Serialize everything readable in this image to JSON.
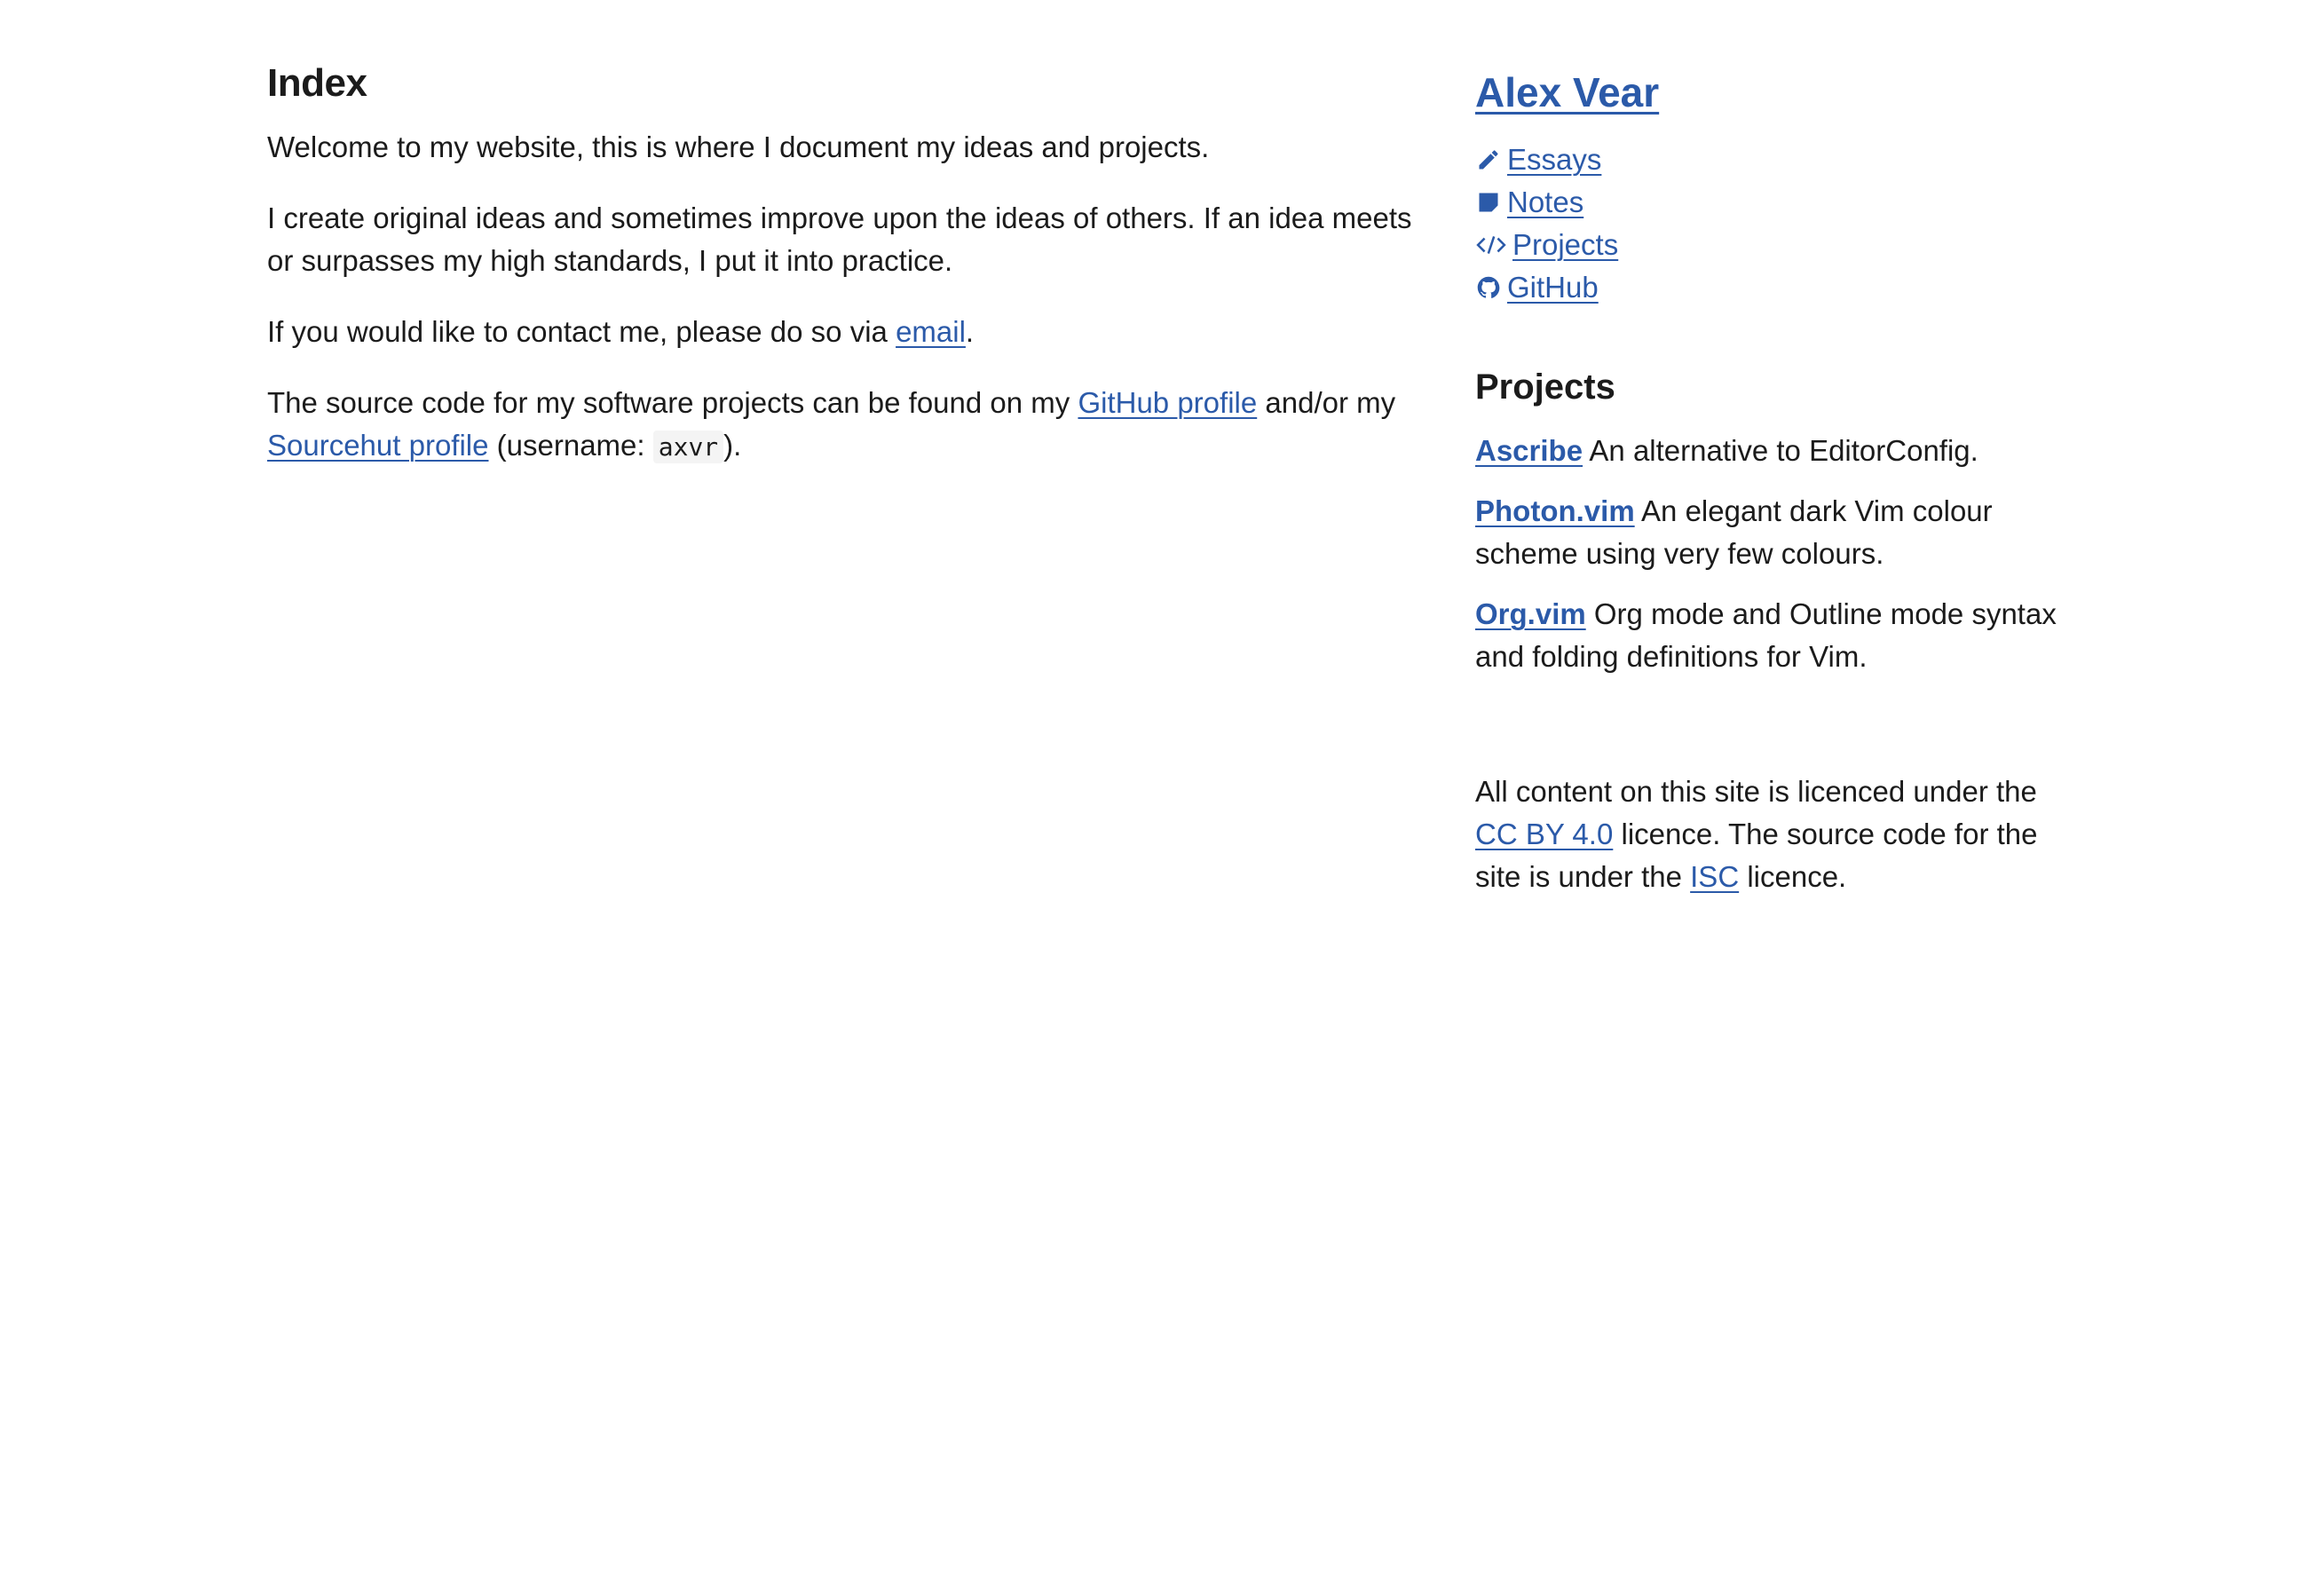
{
  "main": {
    "title": "Index",
    "intro": "Welcome to my website, this is where I document my ideas and projects.",
    "ideas": "I create original ideas and sometimes improve upon the ideas of others. If an idea meets or surpasses my high standards, I put it into practice.",
    "contact_prefix": "If you would like to contact me, please do so via",
    "contact_link": "email",
    "contact_suffix": ".",
    "source_prefix": "The source code for my software projects can be found on my",
    "github_link": "GitHub profile",
    "source_middle": "and/or my",
    "sourcehut_link": "Sourcehut profile",
    "username_prefix": "(username:",
    "username": "axvr",
    "username_suffix": ")."
  },
  "sidebar": {
    "site_title": "Alex Vear",
    "nav": [
      {
        "label": "Essays",
        "icon": "pencil-icon"
      },
      {
        "label": "Notes",
        "icon": "sticky-note-icon"
      },
      {
        "label": "Projects",
        "icon": "code-icon"
      },
      {
        "label": "GitHub",
        "icon": "github-icon"
      }
    ],
    "projects_title": "Projects",
    "projects": [
      {
        "name": "Ascribe",
        "description": "An alternative to EditorConfig."
      },
      {
        "name": "Photon.vim",
        "description": "An elegant dark Vim colour scheme using very few colours."
      },
      {
        "name": "Org.vim",
        "description": "Org mode and Outline mode syntax and folding definitions for Vim."
      }
    ],
    "licence": {
      "prefix": "All content on this site is licenced under the",
      "cc_link": "CC BY 4.0",
      "middle": "licence. The source code for the site is under the",
      "isc_link": "ISC",
      "suffix": "licence."
    }
  },
  "colors": {
    "link": "#2b5aa9",
    "text": "#1b1b1b",
    "background": "#ffffff"
  }
}
